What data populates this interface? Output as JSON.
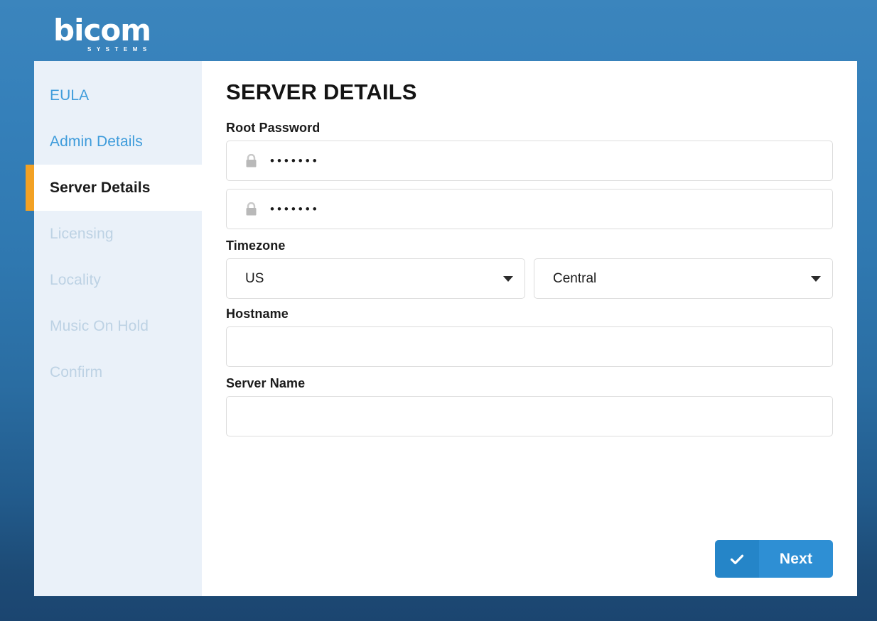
{
  "brand": {
    "name": "bicom",
    "tagline": "SYSTEMS"
  },
  "sidebar": {
    "items": [
      {
        "label": "EULA",
        "state": "done"
      },
      {
        "label": "Admin Details",
        "state": "done"
      },
      {
        "label": "Server Details",
        "state": "active"
      },
      {
        "label": "Licensing",
        "state": "todo"
      },
      {
        "label": "Locality",
        "state": "todo"
      },
      {
        "label": "Music On Hold",
        "state": "todo"
      },
      {
        "label": "Confirm",
        "state": "todo"
      }
    ]
  },
  "main": {
    "title": "SERVER DETAILS",
    "fields": {
      "root_password_label": "Root Password",
      "root_password_value": "•••••••",
      "root_password_confirm_value": "•••••••",
      "timezone_label": "Timezone",
      "timezone_region_value": "US",
      "timezone_zone_value": "Central",
      "hostname_label": "Hostname",
      "hostname_value": "",
      "server_name_label": "Server Name",
      "server_name_value": ""
    }
  },
  "footer": {
    "next_label": "Next"
  },
  "icons": {
    "lock": "lock-icon",
    "caret": "chevron-down-icon",
    "check": "check-icon"
  },
  "colors": {
    "accent_orange": "#f2a124",
    "brand_blue": "#3b85bd",
    "button_blue": "#2e8fd4",
    "button_blue_dark": "#2585c8",
    "sidebar_bg": "#eaf1f9",
    "link_blue": "#3f9cdb",
    "disabled_blue": "#bdd2e4"
  }
}
